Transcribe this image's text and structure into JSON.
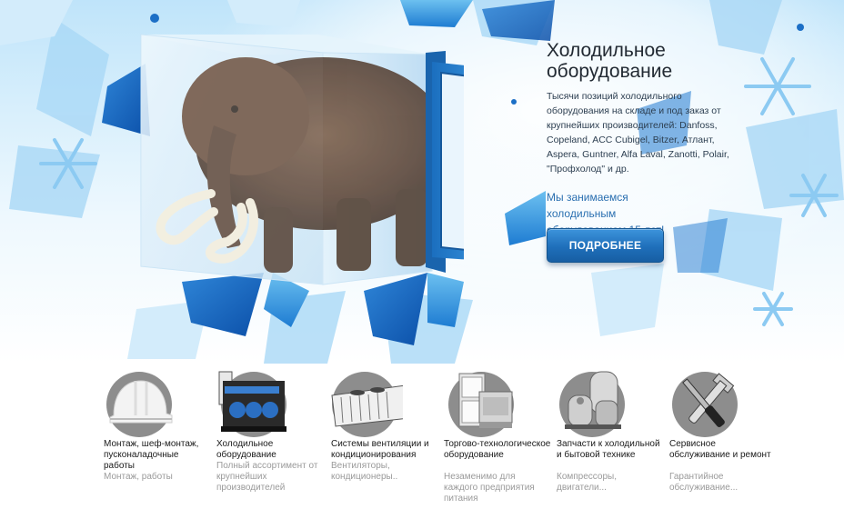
{
  "hero": {
    "title_line1": "Холодильное",
    "title_line2": "оборудование",
    "description": "Тысячи позиций холодильного оборудования на складе и под заказ от крупнейших производителей: Danfoss, Copeland, ACC Cubigel, Bitzer, Атлант, Aspera, Guntner, Alfa Laval, Zanotti, Polair, \"Профхолод\" и др.",
    "years_text": "Мы занимаемся холодильным оборудованием 15 лет!",
    "button_label": "ПОДРОБНЕЕ",
    "accent_color": "#1f6fba"
  },
  "categories": [
    {
      "title": "Монтаж, шеф-монтаж, пусконаладочные работы",
      "subtitle": "Монтаж, работы",
      "icon": "helmet-icon"
    },
    {
      "title": "Холодильное оборудование",
      "subtitle": "Полный ассортимент от крупнейших производителей",
      "icon": "refrigeration-unit-icon"
    },
    {
      "title": "Системы вентиляции и кондиционирования",
      "subtitle": "Вентиляторы, кондиционеры..",
      "icon": "ventilation-unit-icon"
    },
    {
      "title": "Торгово-технологическое оборудование",
      "subtitle": "Незаменимо для каждого предприятия питания",
      "icon": "kitchen-equipment-icon"
    },
    {
      "title": "Запчасти к холодильной и бытовой технике",
      "subtitle": "Компрессоры, двигатели...",
      "icon": "compressor-icon"
    },
    {
      "title": "Сервисное обслуживание и ремонт",
      "subtitle": "Гарантийное обслуживание...",
      "icon": "tools-icon"
    }
  ]
}
